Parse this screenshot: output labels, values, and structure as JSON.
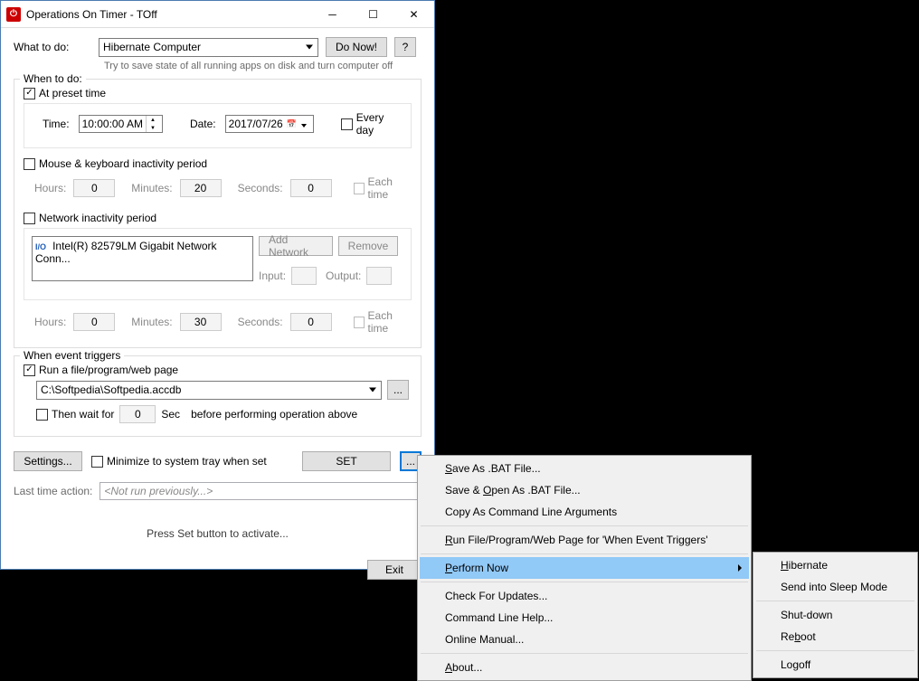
{
  "window": {
    "title": "Operations On Timer - TOff"
  },
  "what": {
    "label": "What to do:",
    "action": "Hibernate Computer",
    "do_now": "Do Now!",
    "help": "?",
    "subtext": "Try to save state of all running apps on disk and turn computer off"
  },
  "when": {
    "legend": "When to do:",
    "preset": {
      "label": "At preset time",
      "time_label": "Time:",
      "time_value": "10:00:00 AM",
      "date_label": "Date:",
      "date_value": "2017/07/26",
      "every_day": "Every day"
    },
    "mouse": {
      "label": "Mouse & keyboard inactivity period",
      "hours_label": "Hours:",
      "hours_val": "0",
      "minutes_label": "Minutes:",
      "minutes_val": "20",
      "seconds_label": "Seconds:",
      "seconds_val": "0",
      "each_time": "Each time"
    },
    "network": {
      "label": "Network inactivity period",
      "adapter": "Intel(R) 82579LM Gigabit Network Conn...",
      "add_btn": "Add Network",
      "remove_btn": "Remove",
      "input_label": "Input:",
      "output_label": "Output:",
      "hours_label": "Hours:",
      "hours_val": "0",
      "minutes_label": "Minutes:",
      "minutes_val": "30",
      "seconds_label": "Seconds:",
      "seconds_val": "0",
      "each_time": "Each time"
    }
  },
  "event": {
    "legend": "When event triggers",
    "run_label": "Run a file/program/web page",
    "path": "C:\\Softpedia\\Softpedia.accdb",
    "browse": "...",
    "wait_label": "Then wait for",
    "wait_val": "0",
    "sec_label": "Sec",
    "before_label": "before performing operation above"
  },
  "footer": {
    "settings": "Settings...",
    "minimize": "Minimize to system tray when set",
    "set_btn": "SET",
    "more": "...",
    "last_action_label": "Last time action:",
    "last_action_val": "<Not run previously...>",
    "status": "Press Set button to activate...",
    "exit": "Exit"
  },
  "menu1": {
    "save_bat": "Save As .BAT File...",
    "save_open_bat": "Save & Open As .BAT File...",
    "copy_args": "Copy As Command Line Arguments",
    "run_file": "Run File/Program/Web Page for 'When Event Triggers'",
    "perform_now": "Perform Now",
    "check_updates": "Check For Updates...",
    "cmd_help": "Command Line Help...",
    "online_manual": "Online Manual...",
    "about": "About..."
  },
  "menu2": {
    "hibernate": "Hibernate",
    "sleep": "Send into Sleep Mode",
    "shutdown": "Shut-down",
    "reboot": "Reboot",
    "logoff": "Logoff"
  }
}
